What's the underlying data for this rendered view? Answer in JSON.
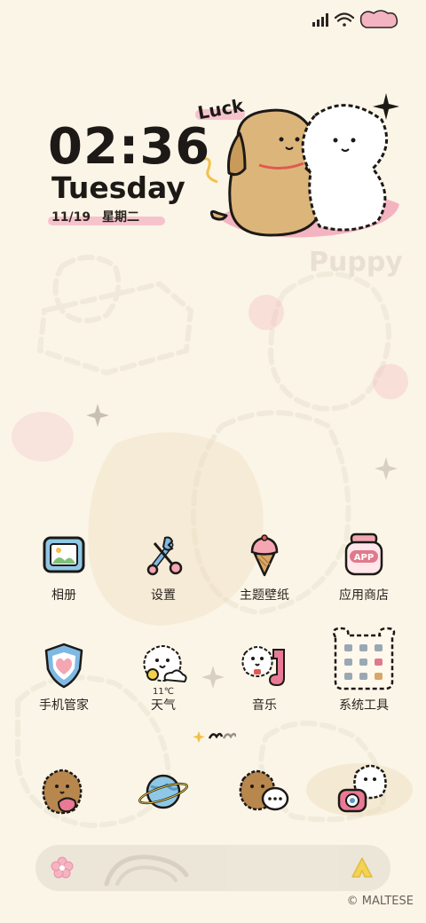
{
  "status": {
    "icons": [
      "signal-icon",
      "wifi-icon",
      "battery-icon"
    ]
  },
  "clock": {
    "time": "02:36",
    "day": "Tuesday",
    "date": "11/19",
    "weekday": "星期二"
  },
  "wallpaper": {
    "luck_text": "Luck",
    "puppy_text": "Puppy"
  },
  "apps": [
    {
      "label": "相册",
      "icon": "photo-album-icon"
    },
    {
      "label": "设置",
      "icon": "settings-tools-icon"
    },
    {
      "label": "主题壁纸",
      "icon": "ice-cream-theme-icon"
    },
    {
      "label": "应用商店",
      "icon": "app-store-jar-icon"
    },
    {
      "label": "手机管家",
      "icon": "shield-heart-icon"
    },
    {
      "label": "天气",
      "icon": "weather-bear-icon",
      "temp": "11℃"
    },
    {
      "label": "音乐",
      "icon": "music-note-bear-icon"
    },
    {
      "label": "系统工具",
      "icon": "tools-folder-icon"
    }
  ],
  "dock": [
    {
      "icon": "phone-puppy-icon"
    },
    {
      "icon": "browser-planet-icon"
    },
    {
      "icon": "messages-puppy-icon"
    },
    {
      "icon": "camera-puppy-icon"
    }
  ],
  "colors": {
    "background": "#fbf5e7",
    "accent_pink": "#f6c3cd",
    "accent_yellow": "#f3d24a"
  },
  "watermark": "© MALTESE"
}
